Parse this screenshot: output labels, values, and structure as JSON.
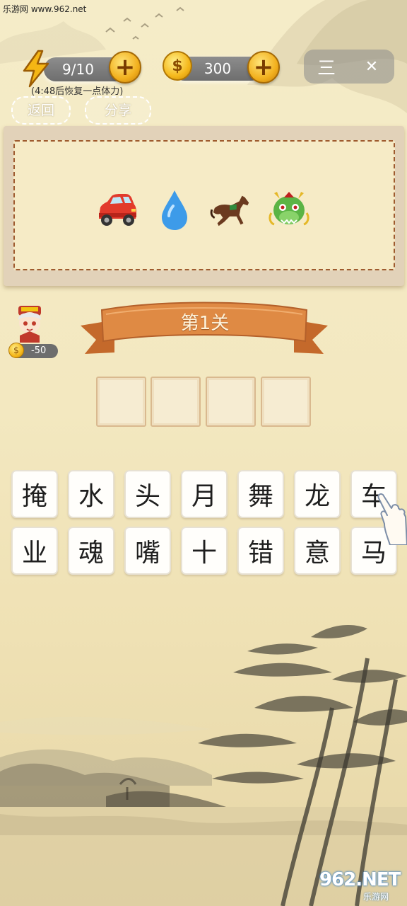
{
  "watermark_top": "乐游网 www.962.net",
  "hud": {
    "energy_value": "9/10",
    "coins_value": "300",
    "recover_text": "(4:48后恢复一点体力)",
    "back_label": "返回",
    "share_label": "分享",
    "menu_glyph": "三",
    "close_glyph": "✕"
  },
  "puzzle": {
    "emoji_items": [
      "car-icon",
      "water-drop-icon",
      "horse-icon",
      "dragon-icon"
    ]
  },
  "level": {
    "title": "第1关",
    "hint_cost": "-50",
    "answer_slots": 4
  },
  "candidates": [
    "掩",
    "水",
    "头",
    "月",
    "舞",
    "龙",
    "车",
    "业",
    "魂",
    "嘴",
    "十",
    "错",
    "意",
    "马"
  ],
  "watermark_bottom": {
    "main": "962.NET",
    "sub": "乐游网"
  },
  "colors": {
    "ribbon": "#d9803a",
    "gold": "#f2b01e",
    "panel_border": "#9e5a2e",
    "background": "#f5ecc8"
  }
}
